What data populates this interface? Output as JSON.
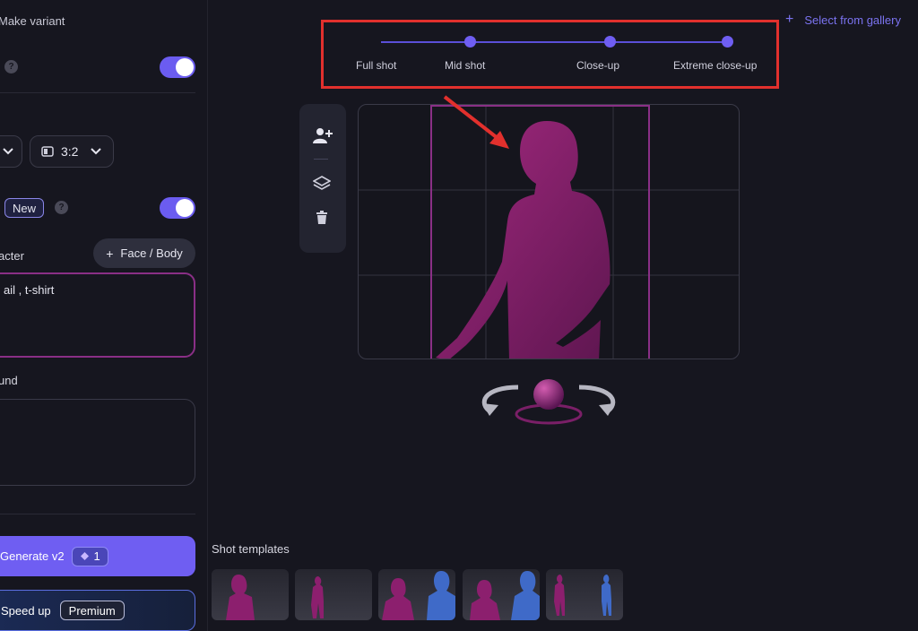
{
  "left_panel": {
    "header_text": "Make variant",
    "help_glyph": "?",
    "new_badge": "New",
    "aspect_ratio": "3:2",
    "character_label": "acter",
    "face_body_button": "Face / Body",
    "character_text": "ail , t-shirt",
    "background_label": "und",
    "background_text": "",
    "generate_label": "Generate v2",
    "generate_cost": "1",
    "speed_up_label": "Speed up",
    "premium_badge": "Premium"
  },
  "shot_selector": {
    "options": [
      "Full shot",
      "Mid shot",
      "Close-up",
      "Extreme close-up"
    ],
    "selected": "Mid shot"
  },
  "gallery_link": "Select from gallery",
  "toolbar_icons": [
    "add-person-icon",
    "layers-icon",
    "trash-icon"
  ],
  "templates": {
    "title": "Shot templates"
  },
  "colors": {
    "accent": "#6f5ef2",
    "figure": "#8c1f6e",
    "highlight_border": "#e2302d",
    "frame": "#8a2f86"
  }
}
